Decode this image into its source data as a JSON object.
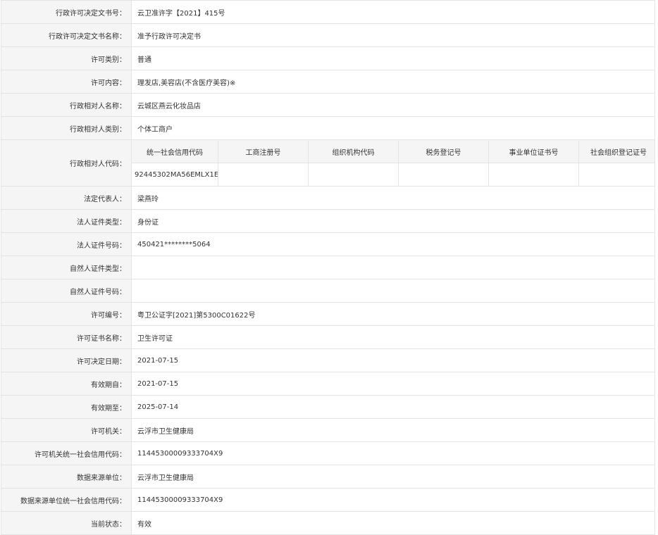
{
  "fields_top": [
    {
      "label": "行政许可决定文书号：",
      "value": "云卫准许字【2021】415号"
    },
    {
      "label": "行政许可决定文书名称：",
      "value": "准予行政许可决定书"
    },
    {
      "label": "许可类别：",
      "value": "普通"
    },
    {
      "label": "许可内容：",
      "value": "理发店,美容店(不含医疗美容)※"
    },
    {
      "label": "行政相对人名称：",
      "value": "云城区燕云化妆品店"
    },
    {
      "label": "行政相对人类别：",
      "value": "个体工商户"
    }
  ],
  "code_block": {
    "label": "行政相对人代码：",
    "headers": [
      "统一社会信用代码",
      "工商注册号",
      "组织机构代码",
      "税务登记号",
      "事业单位证书号",
      "社会组织登记证号"
    ],
    "values": [
      "92445302MA56EMLX1E",
      "",
      "",
      "",
      "",
      ""
    ]
  },
  "fields_bottom": [
    {
      "label": "法定代表人：",
      "value": "梁燕玲"
    },
    {
      "label": "法人证件类型：",
      "value": "身份证"
    },
    {
      "label": "法人证件号码：",
      "value": "450421********5064"
    },
    {
      "label": "自然人证件类型：",
      "value": ""
    },
    {
      "label": "自然人证件号码：",
      "value": ""
    },
    {
      "label": "许可编号：",
      "value": "粤卫公证字[2021]第5300C01622号"
    },
    {
      "label": "许可证书名称：",
      "value": "卫生许可证"
    },
    {
      "label": "许可决定日期：",
      "value": "2021-07-15"
    },
    {
      "label": "有效期自：",
      "value": "2021-07-15"
    },
    {
      "label": "有效期至：",
      "value": "2025-07-14"
    },
    {
      "label": "许可机关：",
      "value": "云浮市卫生健康局"
    },
    {
      "label": "许可机关统一社会信用代码：",
      "value": "11445300009333704X9"
    },
    {
      "label": "数据来源单位：",
      "value": "云浮市卫生健康局"
    },
    {
      "label": "数据来源单位统一社会信用代码：",
      "value": "11445300009333704X9"
    },
    {
      "label": "当前状态：",
      "value": "有效"
    }
  ]
}
